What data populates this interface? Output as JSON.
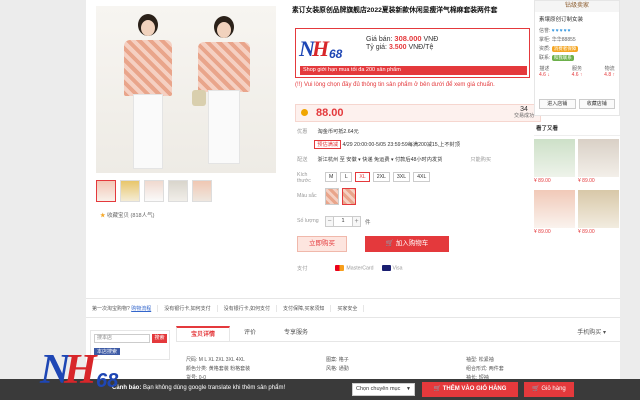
{
  "product": {
    "title": "素订女装原创品牌旗舰店2022夏装新款休闲显瘦洋气棉麻套装两件套",
    "favorite": "收藏宝贝 (818人气)",
    "price": "88.00",
    "sold_count": "34",
    "sold_label": "交易成功",
    "labels": {
      "discount": "优惠",
      "shipping": "配送",
      "size": "Kích thước",
      "color": "Màu sắc",
      "quantity": "Số lượng",
      "payment": "支付"
    },
    "discount_text": "淘金币可抵2.64元",
    "presale_tag": "预估满减",
    "presale_text": "4/29 20:00:00-5/05 23:59:59每满200减15,上不封顶",
    "shipping_text": "浙江杭州 至 安徽 ▾  快递 免运费 ▾  付款后48小时内发货",
    "only_jpn": "只能购买",
    "sizes": [
      "M",
      "L",
      "XL",
      "2XL",
      "3XL",
      "4XL"
    ],
    "selected_size": "XL",
    "quantity": "1",
    "qty_unit": "件",
    "buy_now": "立即购买",
    "add_cart": "加入购物车",
    "pay_methods": [
      "MasterCard",
      "Visa"
    ]
  },
  "promo": {
    "gia_ban_label": "Giá bán:",
    "gia_ban_value": "308.000",
    "gia_ban_unit": "VNĐ",
    "ty_gia_label": "Tỷ giá:",
    "ty_gia_value": "3.500",
    "ty_gia_unit": "VNĐ/Tệ",
    "limit": "Shop giới hạn mua tối đa 200 sản phẩm",
    "notice": "(!!) Vui lòng chọn đầy đủ thông tin sản phẩm ở bên dưới để xem giá chuẩn."
  },
  "store": {
    "header": "钻级卖家",
    "name": "素壤原创订制女装",
    "credit_label": "信誉:",
    "hearts": "♥♥♥♥♥",
    "keeper_label": "掌柜:",
    "keeper": "华华88855",
    "qual_label": "资质:",
    "qual_badge": "消费者保障",
    "contact_label": "联系:",
    "contact_badge": "和我联系",
    "scores": [
      {
        "label": "描述",
        "value": "4.6 ↓"
      },
      {
        "label": "服务",
        "value": "4.6 ↑"
      },
      {
        "label": "物流",
        "value": "4.8 ↑"
      }
    ],
    "enter": "进入店铺",
    "follow": "收藏店铺"
  },
  "seen": {
    "title": "看了又看",
    "prices": [
      "¥ 89.00",
      "¥ 89.00",
      "¥ 89.00",
      "¥ 89.00"
    ]
  },
  "links": {
    "first": "第一次淘宝购物?",
    "first_link": "购物流程",
    "items": [
      "没有银行卡,如何支付",
      "没有银行卡,如何支付",
      "支付保障,买家须知",
      "买家安全"
    ]
  },
  "sidebox": {
    "placeholder": "搜本店",
    "go": "搜索",
    "label": "本店搜索"
  },
  "tabs": [
    "宝贝详情",
    "评价",
    "专享服务",
    "手机购买"
  ],
  "attrs": [
    [
      "尺码: M L XL 2XL 3XL 4XL",
      "图案: 格子",
      "袖型: 松紧袖"
    ],
    [
      "颜色分类: 黄格套装 粉格套装",
      "风格: 通勤",
      "组合形式: 两件套"
    ],
    [
      "货号: 0-0",
      "",
      "袖长: 短袖"
    ]
  ],
  "bar": {
    "msg_label": "Cảnh báo:",
    "msg": "Bạn không dùng google translate khi thêm sản phẩm!",
    "select": "Chọn chuyên mục",
    "add": "THÊM VÀO GIỎ HÀNG",
    "cart": "Giỏ hàng"
  },
  "brand": {
    "n": "N",
    "h": "H",
    "num": "68"
  },
  "colors": {
    "accent": "#e4393c",
    "brand_blue": "#1e46b4",
    "brand_red": "#d8262a"
  }
}
